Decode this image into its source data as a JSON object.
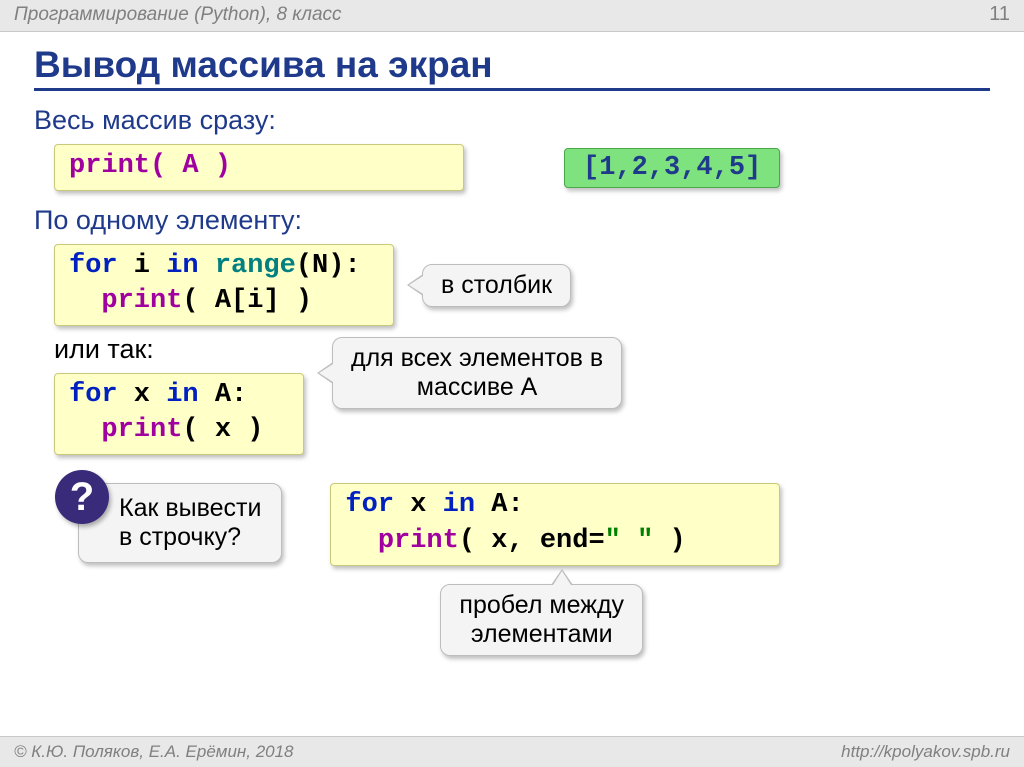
{
  "header": {
    "course": "Программирование (Python), 8 класс",
    "page": "11"
  },
  "title": "Вывод массива на экран",
  "s1": {
    "heading": "Весь массив сразу:",
    "code": "print( A )",
    "output": "[1,2,3,4,5]"
  },
  "s2": {
    "heading": "По одному элементу:",
    "code_l1_for": "for",
    "code_l1_i": " i ",
    "code_l1_in": "in",
    "code_l1_range": " range",
    "code_l1_tail": "(N):",
    "code_l2_print": "print",
    "code_l2_tail": "( A[i] )",
    "note": "в столбик"
  },
  "s3": {
    "or": "или так:",
    "code_l1_for": "for",
    "code_l1_x": " x ",
    "code_l1_in": "in",
    "code_l1_tail": " A:",
    "code_l2_print": "print",
    "code_l2_tail": "( x )",
    "note_l1": "для всех элементов в",
    "note_l2": "массиве A"
  },
  "q": {
    "mark": "?",
    "line1": "Как вывести",
    "line2": "в строчку?"
  },
  "s4": {
    "code_l1_for": "for",
    "code_l1_x": " x ",
    "code_l1_in": "in",
    "code_l1_tail": " A:",
    "code_l2_print": "print",
    "code_l2_mid": "( x, end=",
    "code_l2_str": "\" \"",
    "code_l2_end": " )",
    "note_l1": "пробел между",
    "note_l2": "элементами"
  },
  "footer": {
    "left": "© К.Ю. Поляков, Е.А. Ерёмин, 2018",
    "right": "http://kpolyakov.spb.ru"
  }
}
